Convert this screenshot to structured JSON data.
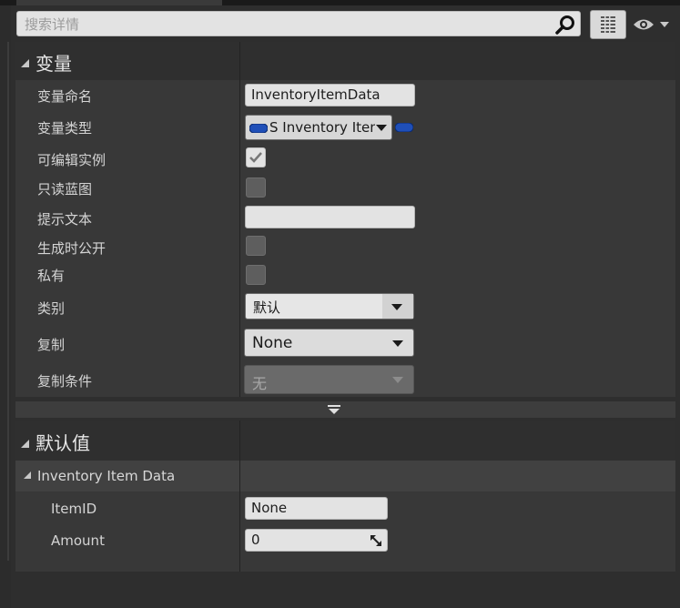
{
  "search": {
    "placeholder": "搜索详情"
  },
  "toolbar": {
    "grid_icon": "grid-view-icon",
    "eye_icon": "eye-icon"
  },
  "variable_section": {
    "title": "变量",
    "rows": {
      "name": {
        "label": "变量命名",
        "value": "InventoryItemData"
      },
      "type": {
        "label": "变量类型",
        "value": "S Inventory Item"
      },
      "instance_editable": {
        "label": "可编辑实例",
        "checked": true
      },
      "blueprint_readonly": {
        "label": "只读蓝图",
        "checked": false
      },
      "tooltip": {
        "label": "提示文本",
        "value": ""
      },
      "expose_on_spawn": {
        "label": "生成时公开",
        "checked": false
      },
      "private": {
        "label": "私有",
        "checked": false
      },
      "category": {
        "label": "类别",
        "value": "默认"
      },
      "replication": {
        "label": "复制",
        "value": "None"
      },
      "replication_condition": {
        "label": "复制条件",
        "value": "无"
      }
    }
  },
  "default_section": {
    "title": "默认值",
    "struct_label": "Inventory Item Data",
    "fields": {
      "item_id": {
        "label": "ItemID",
        "value": "None"
      },
      "amount": {
        "label": "Amount",
        "value": "0"
      }
    }
  },
  "colors": {
    "panel": "#383838",
    "header": "#2f2f2f",
    "pin_blue": "#1f4fb8"
  }
}
